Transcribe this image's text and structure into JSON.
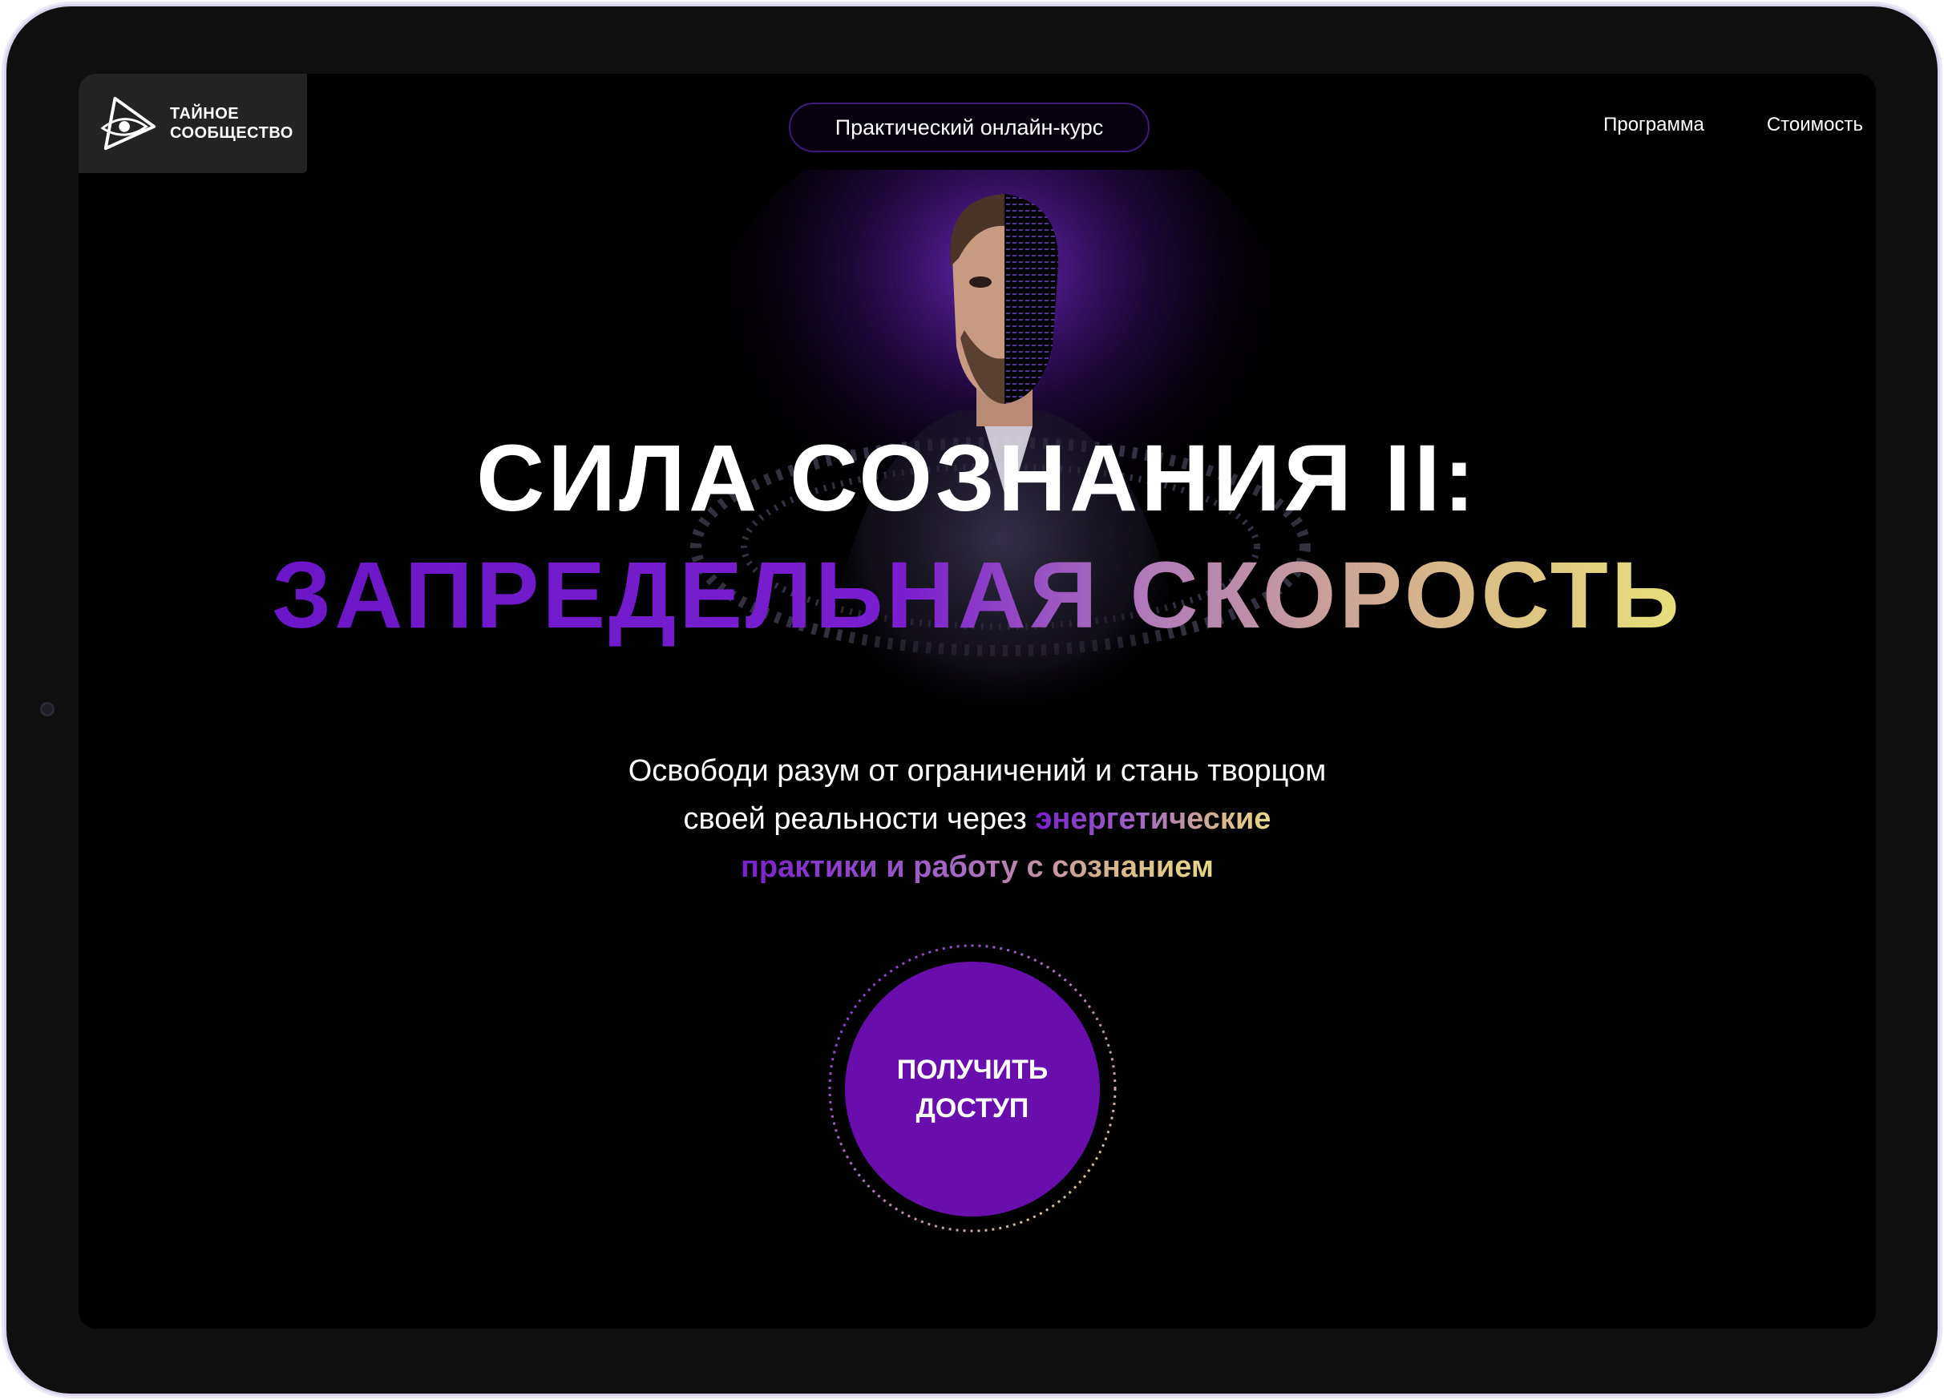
{
  "header": {
    "logo_line1": "ТАЙНОЕ",
    "logo_line2": "СООБЩЕСТВО",
    "course_label": "Практический онлайн-курс",
    "nav": [
      {
        "label": "Программа"
      },
      {
        "label": "Стоимость"
      }
    ]
  },
  "hero": {
    "title_line1": "СИЛА СОЗНАНИЯ II:",
    "title_line2": "ЗАПРЕДЕЛЬНАЯ СКОРОСТЬ",
    "subtitle_part1": "Освободи разум от ограничений и стань творцом",
    "subtitle_part2": "своей реальности через ",
    "subtitle_highlight1": "энергетические",
    "subtitle_highlight2": "практики и работу с сознанием",
    "cta_label": "ПОЛУЧИТЬ\nДОСТУП"
  },
  "colors": {
    "background": "#000000",
    "accent_purple": "#6a0dad",
    "gradient_gold": "#e6e07a"
  },
  "icons": {
    "logo": "triangle-eye-icon"
  }
}
